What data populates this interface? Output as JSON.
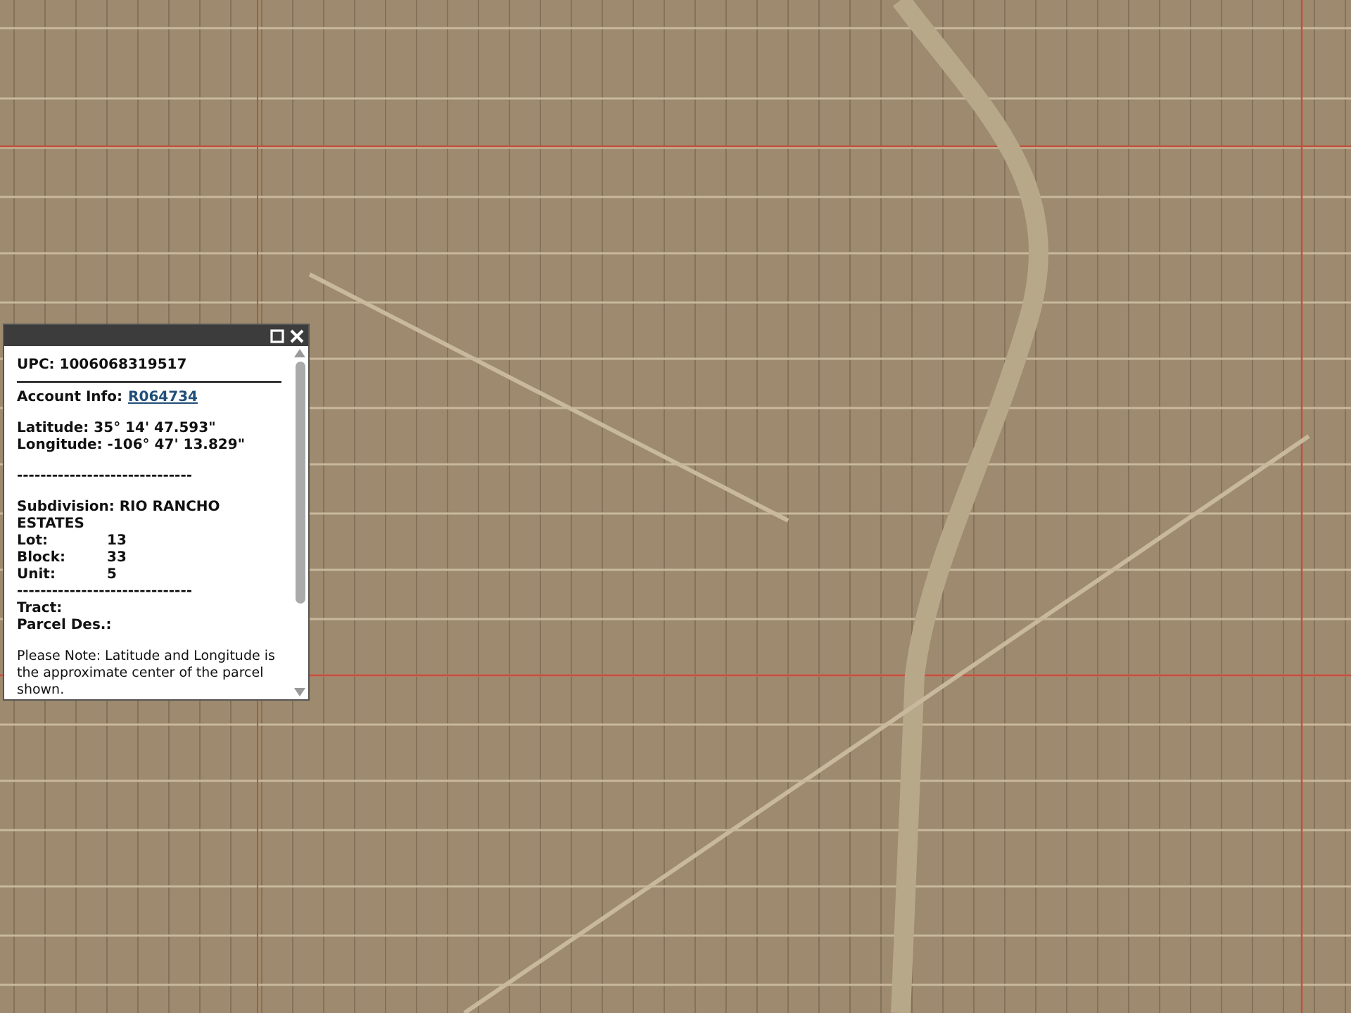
{
  "popup": {
    "upc": "UPC: 1006068319517",
    "account_label": "Account Info:",
    "account_link": "R064734",
    "latitude": "Latitude: 35° 14' 47.593\"",
    "longitude": "Longitude: -106° 47' 13.829\"",
    "divider_1": "------------------------------",
    "subdivision": "Subdivision: RIO RANCHO ESTATES",
    "fields": [
      {
        "label": "Lot:",
        "value": "13"
      },
      {
        "label": "Block:",
        "value": "33"
      },
      {
        "label": "Unit:",
        "value": "5"
      }
    ],
    "divider_2": "------------------------------",
    "tract": "Tract:",
    "parcel_des": "Parcel Des.:",
    "note": "Please Note: Latitude and Longitude is the approximate center of the parcel shown."
  }
}
